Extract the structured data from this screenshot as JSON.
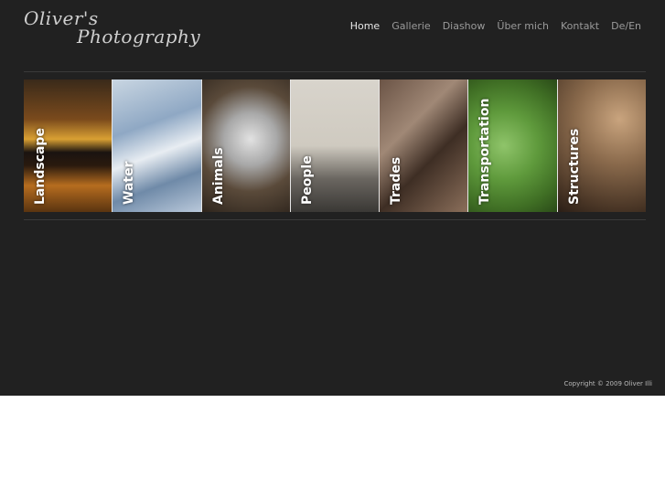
{
  "logo": {
    "line1": "Oliver's",
    "line2": "Photography"
  },
  "nav": {
    "items": [
      {
        "label": "Home",
        "active": true
      },
      {
        "label": "Gallerie"
      },
      {
        "label": "Diashow"
      },
      {
        "label": "Über mich"
      },
      {
        "label": "Kontakt"
      },
      {
        "label": "De/En"
      }
    ]
  },
  "categories": [
    {
      "label": "Landscape"
    },
    {
      "label": "Water"
    },
    {
      "label": "Animals"
    },
    {
      "label": "People"
    },
    {
      "label": "Trades"
    },
    {
      "label": "Transportation"
    },
    {
      "label": "Structures"
    }
  ],
  "footer": {
    "copyright": "Copyright © 2009 Oliver Illi"
  }
}
